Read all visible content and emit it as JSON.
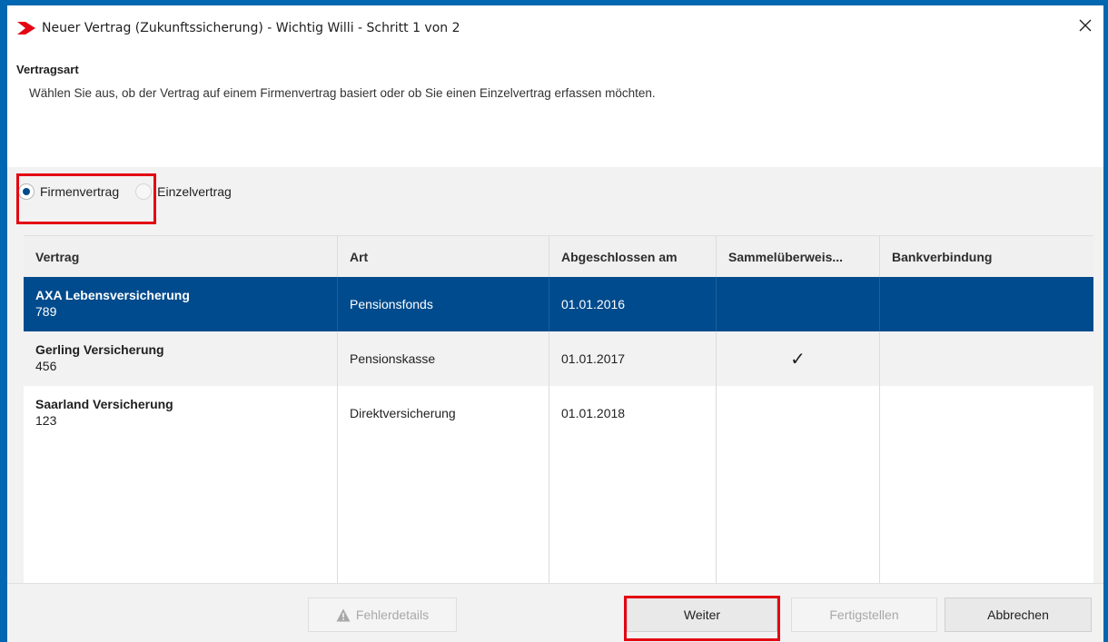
{
  "window": {
    "title": "Neuer Vertrag (Zukunftssicherung) - Wichtig Willi - Schritt 1 von 2"
  },
  "header": {
    "title": "Vertragsart",
    "description": "Wählen Sie aus, ob der Vertrag auf einem Firmenvertrag basiert oder ob Sie einen Einzelvertrag erfassen möchten."
  },
  "radio": {
    "options": [
      {
        "label": "Firmenvertrag",
        "selected": true
      },
      {
        "label": "Einzelvertrag",
        "selected": false
      }
    ]
  },
  "table": {
    "columns": [
      "Vertrag",
      "Art",
      "Abgeschlossen am",
      "Sammelüberweis...",
      "Bankverbindung"
    ],
    "rows": [
      {
        "name": "AXA Lebensversicherung",
        "number": "789",
        "art": "Pensionsfonds",
        "date": "01.01.2016",
        "sammel": "",
        "bank": "",
        "selected": true
      },
      {
        "name": "Gerling Versicherung",
        "number": "456",
        "art": "Pensionskasse",
        "date": "01.01.2017",
        "sammel": "✓",
        "bank": "",
        "selected": false
      },
      {
        "name": "Saarland Versicherung",
        "number": "123",
        "art": "Direktversicherung",
        "date": "01.01.2018",
        "sammel": "",
        "bank": "",
        "selected": false
      }
    ]
  },
  "footer": {
    "fehler_label": "Fehlerdetails",
    "weiter_label": "Weiter",
    "fertig_label": "Fertigstellen",
    "abbrechen_label": "Abbrechen"
  },
  "colors": {
    "accent": "#004b8d",
    "frame": "#0067b0",
    "highlight": "#e30613",
    "logo": "#e30613"
  },
  "icons": {
    "logo": "chevron-right-logo-icon",
    "close": "close-icon",
    "warning": "warning-icon",
    "check": "checkmark-icon"
  }
}
